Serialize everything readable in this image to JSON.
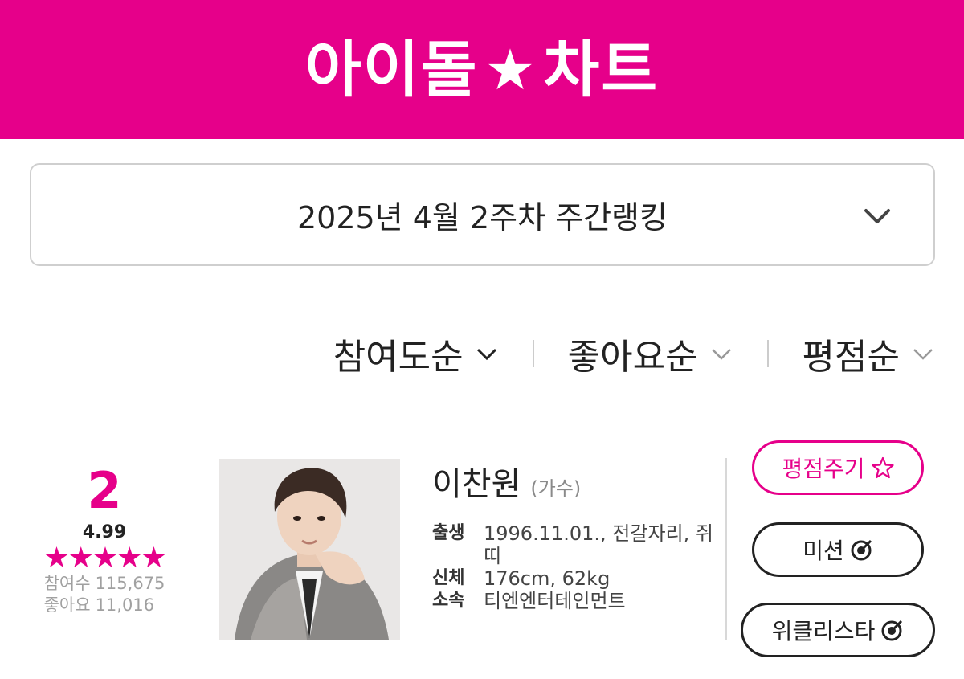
{
  "header": {
    "logo_left": "아이돌",
    "logo_star": "★",
    "logo_right": "차트"
  },
  "week_select": {
    "label": "2025년 4월 2주차 주간랭킹",
    "icon": "chevron-down-icon"
  },
  "sort_options": [
    {
      "label": "참여도순",
      "active": true
    },
    {
      "label": "좋아요순",
      "active": false
    },
    {
      "label": "평점순",
      "active": false
    }
  ],
  "entry": {
    "rank": "2",
    "rating": "4.99",
    "stars": "★★★★★",
    "participants_label": "참여수",
    "participants_value": "115,675",
    "likes_label": "좋아요",
    "likes_value": "11,016",
    "name": "이찬원",
    "job": "(가수)",
    "details": [
      {
        "key": "출생",
        "value": "1996.11.01., 전갈자리, 쥐띠"
      },
      {
        "key": "신체",
        "value": "176cm, 62kg"
      },
      {
        "key": "소속",
        "value": "티엔엔터테인먼트"
      }
    ]
  },
  "buttons": {
    "rate": "평점주기",
    "mission": "미션",
    "weekly_star": "위클리스타"
  },
  "colors": {
    "brand": "#e6008a",
    "text": "#222222",
    "muted": "#a0a0a0"
  }
}
